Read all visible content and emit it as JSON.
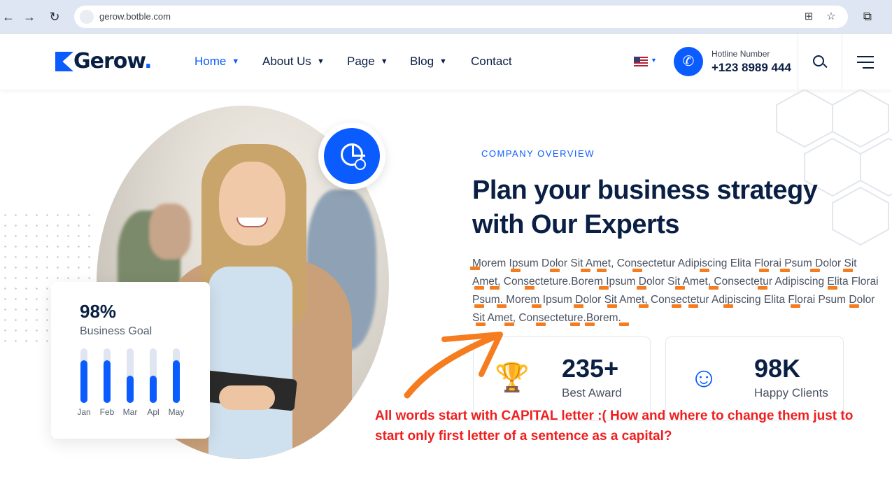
{
  "browser": {
    "back_icon": "arrow-left-icon",
    "forward_icon": "arrow-right-icon",
    "reload_icon": "reload-icon",
    "url": "gerow.botble.com",
    "translate_icon": "translate-icon",
    "bookmark_icon": "star-icon",
    "extensions_icon": "puzzle-icon"
  },
  "header": {
    "logo_text": "Gerow",
    "logo_dot": ".",
    "menu": [
      {
        "label": "Home",
        "active": true,
        "dropdown": true
      },
      {
        "label": "About Us",
        "dropdown": true
      },
      {
        "label": "Page",
        "dropdown": true
      },
      {
        "label": "Blog",
        "dropdown": true
      },
      {
        "label": "Contact",
        "dropdown": false
      }
    ],
    "language_icon": "us-flag-icon",
    "hotline_label": "Hotline Number",
    "hotline_number": "+123 8989 444"
  },
  "hero": {
    "goal_value": "98%",
    "goal_label": "Business Goal",
    "goal_chart": {
      "months": [
        "Jan",
        "Feb",
        "Mar",
        "Apl",
        "May"
      ],
      "levels": [
        0.78,
        0.78,
        0.5,
        0.5,
        0.78
      ]
    },
    "eyebrow": "COMPANY OVERVIEW",
    "heading": "Plan your business strategy with Our Experts",
    "paragraph": "Morem Ipsum Dolor Sit Amet, Consectetur Adipiscing Elita Florai Psum Dolor Sit Amet, Consecteture.Borem Ipsum Dolor Sit Amet, Consectetur Adipiscing Elita Florai Psum. Morem Ipsum Dolor Sit Amet, Consectetur Adipiscing Elita Florai Psum Dolor Sit Amet, Consecteture.Borem.",
    "stats": [
      {
        "value": "235+",
        "label": "Best Award",
        "icon": "trophy-icon"
      },
      {
        "value": "98K",
        "label": "Happy Clients",
        "icon": "clients-icon"
      }
    ]
  },
  "annotation": {
    "text": "All words start with CAPITAL letter :( How and where to change them just to start only first letter of a sentence as a capital?",
    "color": "#f01e1e",
    "mark_color": "#f57c1f"
  },
  "colors": {
    "brand": "#0a5cff",
    "navy": "#0a1f44"
  }
}
